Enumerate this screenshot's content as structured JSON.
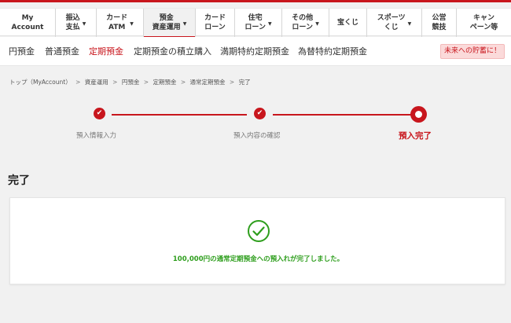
{
  "colors": {
    "brand_red": "#c8161d",
    "success_green": "#2e9e1d"
  },
  "top_nav": [
    {
      "label": "My\nAccount",
      "caret": false
    },
    {
      "label": "振込\n支払",
      "caret": true
    },
    {
      "label": "カード\nATM",
      "caret": true
    },
    {
      "label": "預金\n資産運用",
      "caret": true,
      "active": true
    },
    {
      "label": "カード\nローン",
      "caret": false
    },
    {
      "label": "住宅\nローン",
      "caret": true
    },
    {
      "label": "その他\nローン",
      "caret": true
    },
    {
      "label": "宝くじ",
      "caret": false
    },
    {
      "label": "スポーツ\nくじ",
      "caret": true
    },
    {
      "label": "公営\n競技",
      "caret": false
    },
    {
      "label": "キャン\nペーン等",
      "caret": false
    }
  ],
  "sub_nav": [
    {
      "label": "円預金"
    },
    {
      "label": "普通預金"
    },
    {
      "label": "定期預金",
      "active": true
    },
    {
      "label": "定期預金の積立購入"
    },
    {
      "label": "満期特約定期預金"
    },
    {
      "label": "為替特約定期預金"
    }
  ],
  "promo_label": "未来への貯蓄に！",
  "breadcrumb": [
    "トップ（MyAccount）",
    "資産運用",
    "円預金",
    "定期預金",
    "通常定期預金",
    "完了"
  ],
  "breadcrumb_separator": ">",
  "steps": [
    {
      "label": "預入情報入力",
      "state": "done",
      "icon": "check-icon"
    },
    {
      "label": "預入内容の確認",
      "state": "done",
      "icon": "check-icon"
    },
    {
      "label": "預入完了",
      "state": "current",
      "icon": "current-step-icon"
    }
  ],
  "check_glyph": "✔",
  "section_title": "完了",
  "completion": {
    "icon": "success-check-icon",
    "message": "100,000円の通常定期預金への預入れが完了しました。"
  }
}
